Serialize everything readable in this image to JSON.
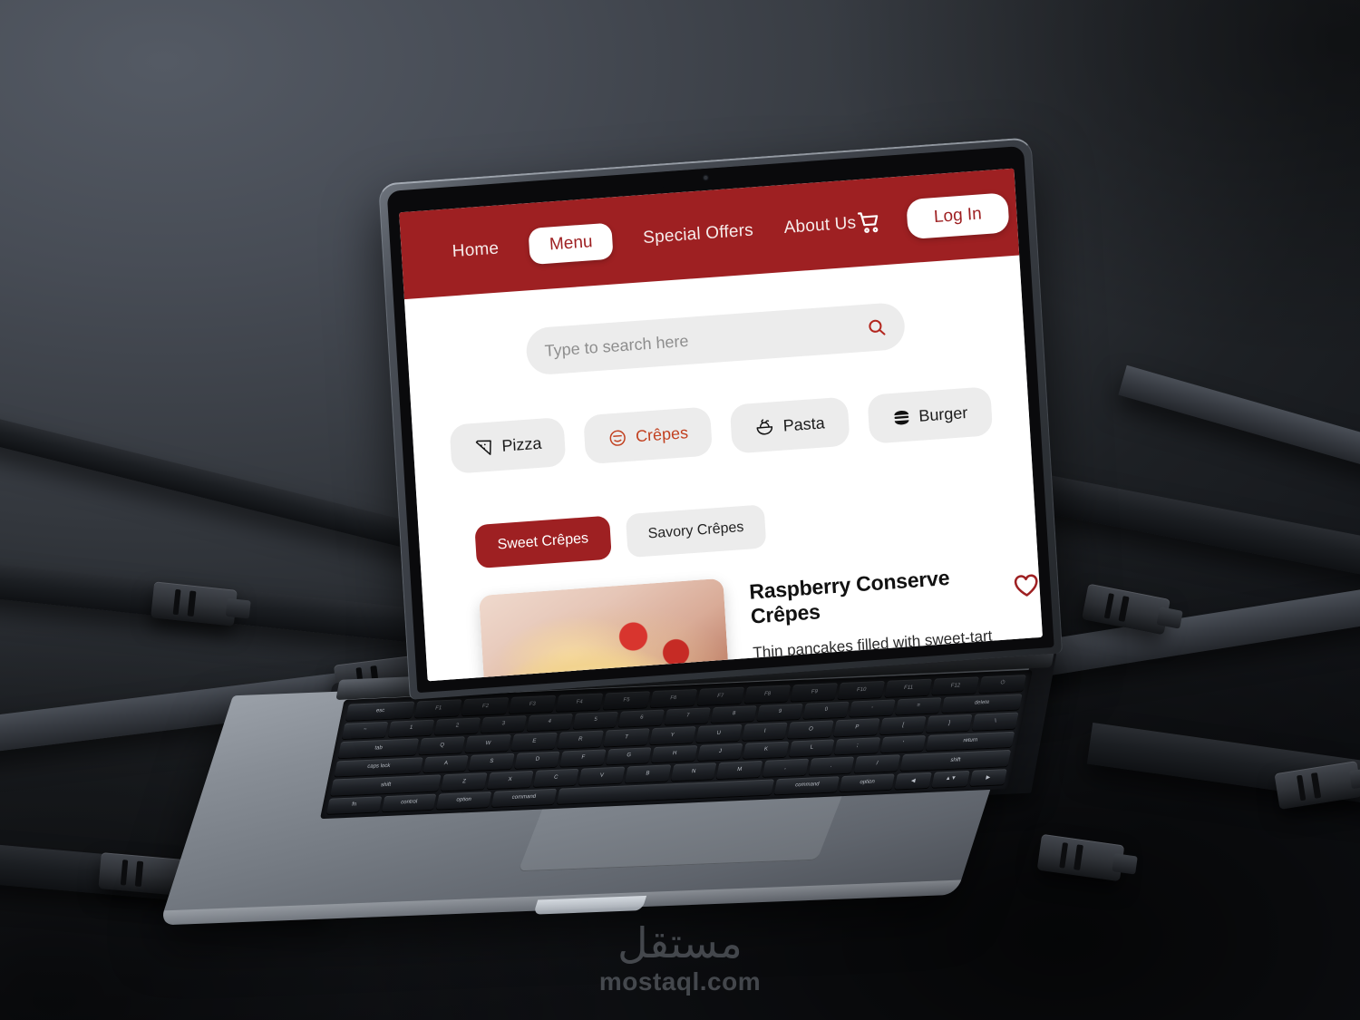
{
  "site": {
    "navbar": {
      "links": [
        {
          "label": "Home",
          "active": false
        },
        {
          "label": "Menu",
          "active": true
        },
        {
          "label": "Special Offers",
          "active": false
        },
        {
          "label": "About Us",
          "active": false
        }
      ],
      "cart_icon": "shopping-cart-icon",
      "login_label": "Log In",
      "bg_color": "#9E2022"
    },
    "search": {
      "placeholder": "Type to search here",
      "value": "",
      "icon": "search-icon",
      "icon_color": "#B3261E"
    },
    "categories": [
      {
        "label": "Pizza",
        "icon": "pizza-slice-icon",
        "active": false
      },
      {
        "label": "Crêpes",
        "icon": "crepe-icon",
        "active": true
      },
      {
        "label": "Pasta",
        "icon": "pasta-bowl-icon",
        "active": false
      },
      {
        "label": "Burger",
        "icon": "burger-icon",
        "active": false
      }
    ],
    "tabs": [
      {
        "label": "Sweet Crêpes",
        "selected": true
      },
      {
        "label": "Savory Crêpes",
        "selected": false
      }
    ],
    "dish": {
      "title": "Raspberry Conserve Crêpes",
      "description": "Thin pancakes filled with sweet-tart raspberry jam, often garnished with powdered sugar and fresh berries. Perfect for breakfast or dessert.",
      "favorite_icon": "heart-outline-icon",
      "favorite_color": "#9E2022",
      "image": "raspberry-crepes-photo"
    },
    "accent_color": "#9E2022",
    "chip_active_color": "#C2401F"
  },
  "watermark": {
    "arabic": "مستقل",
    "latin": "mostaql.com"
  },
  "device": {
    "type": "laptop-macbook",
    "keyboard": {
      "row1": [
        "esc",
        "F1",
        "F2",
        "F3",
        "F4",
        "F5",
        "F6",
        "F7",
        "F8",
        "F9",
        "F10",
        "F11",
        "F12",
        "⏻"
      ],
      "row2": [
        "~",
        "1",
        "2",
        "3",
        "4",
        "5",
        "6",
        "7",
        "8",
        "9",
        "0",
        "-",
        "=",
        "delete"
      ],
      "row3": [
        "tab",
        "Q",
        "W",
        "E",
        "R",
        "T",
        "Y",
        "U",
        "I",
        "O",
        "P",
        "[",
        "]",
        "\\"
      ],
      "row4": [
        "caps lock",
        "A",
        "S",
        "D",
        "F",
        "G",
        "H",
        "J",
        "K",
        "L",
        ";",
        "'",
        "return"
      ],
      "row5": [
        "shift",
        "Z",
        "X",
        "C",
        "V",
        "B",
        "N",
        "M",
        ",",
        ".",
        "/",
        "shift"
      ],
      "row6": [
        "fn",
        "control",
        "option",
        "command",
        "",
        "command",
        "option",
        "◀",
        "▲▼",
        "▶"
      ]
    }
  }
}
